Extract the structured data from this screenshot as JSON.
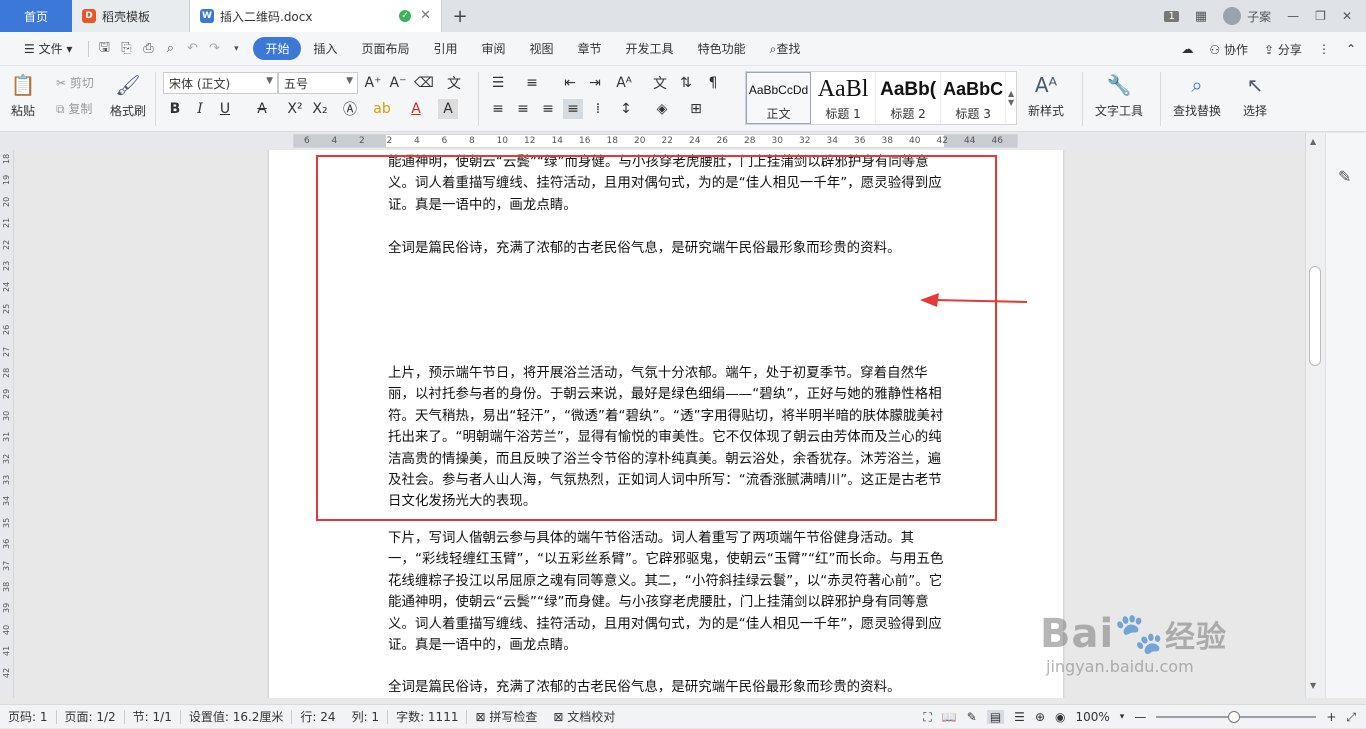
{
  "tabs": {
    "home": "首页",
    "docer": "稻壳模板",
    "doc": "插入二维码.docx",
    "new_tab": "+",
    "badge": "1",
    "user": "子案"
  },
  "menu": {
    "file": "文件",
    "items": [
      "开始",
      "插入",
      "页面布局",
      "引用",
      "审阅",
      "视图",
      "章节",
      "开发工具",
      "特色功能"
    ],
    "search": "查找",
    "collab": "协作",
    "share": "分享"
  },
  "ribbon": {
    "paste": "粘贴",
    "cut": "剪切",
    "copy": "复制",
    "format_painter": "格式刷",
    "font_name": "宋体 (正文)",
    "font_size": "五号",
    "styles": [
      {
        "preview": "AaBbCcDd",
        "name": "正文"
      },
      {
        "preview": "AaBl",
        "name": "标题 1"
      },
      {
        "preview": "AaBb(",
        "name": "标题 2"
      },
      {
        "preview": "AaBbC",
        "name": "标题 3"
      }
    ],
    "new_style": "新样式",
    "text_tools": "文字工具",
    "find_replace": "查找替换",
    "select": "选择"
  },
  "ruler_numbers": [
    "6",
    "4",
    "2",
    "2",
    "4",
    "6",
    "8",
    "10",
    "12",
    "14",
    "16",
    "18",
    "20",
    "22",
    "24",
    "26",
    "28",
    "30",
    "32",
    "34",
    "36",
    "38",
    "40",
    "42",
    "44",
    "46"
  ],
  "vruler_numbers": [
    "18",
    "19",
    "20",
    "21",
    "22",
    "23",
    "24",
    "25",
    "26",
    "27",
    "28",
    "29",
    "30",
    "31",
    "32",
    "33",
    "34",
    "35",
    "36",
    "37",
    "38",
    "39",
    "40",
    "41",
    "42"
  ],
  "document": {
    "p1": "能通神明，使朝云“云鬓”“绿”而身健。与小孩穿老虎腰肚，门上挂蒲剑以辟邪护身有同等意义。词人着重描写缠线、挂符活动，且用对偶句式，为的是“佳人相见一千年”，愿灵验得到应证。真是一语中的，画龙点睛。",
    "p2": "全词是篇民俗诗，充满了浓郁的古老民俗气息，是研究端午民俗最形象而珍贵的资料。",
    "p3": "上片，预示端午节日，将开展浴兰活动，气氛十分浓郁。端午，处于初夏季节。穿着自然华丽，以衬托参与者的身份。于朝云来说，最好是绿色细绢——“碧纨”，正好与她的雅静性格相符。天气稍热，易出“轻汗”，“微透”着“碧纨”。“透”字用得贴切，将半明半暗的肤体朦胧美衬托出来了。“明朝端午浴芳兰”，显得有愉悦的审美性。它不仅体现了朝云由芳体而及兰心的纯洁高贵的情操美，而且反映了浴兰令节俗的淳朴纯真美。朝云浴处，余香犹存。沐芳浴兰，遍及社会。参与者人山人海，气氛热烈，正如词人词中所写：“流香涨腻满晴川”。这正是古老节日文化发扬光大的表现。",
    "p4": "下片，写词人偕朝云参与具体的端午节俗活动。词人着重写了两项端午节俗健身活动。其一，“彩线轻缠红玉臂”，“以五彩丝系臂”。它辟邪驱鬼，使朝云“玉臂”“红”而长命。与用五色花线缠粽子投江以吊屈原之魂有同等意义。其二，“小符斜挂绿云鬟”，以“赤灵符著心前”。它能通神明，使朝云“云鬓”“绿”而身健。与小孩穿老虎腰肚，门上挂蒲剑以辟邪护身有同等意义。词人着重描写缠线、挂符活动，且用对偶句式，为的是“佳人相见一千年”，愿灵验得到应证。真是一语中的，画龙点睛。",
    "p5": "全词是篇民俗诗，充满了浓郁的古老民俗气息，是研究端午民俗最形象而珍贵的资料。"
  },
  "status": {
    "page_num": "页码: 1",
    "pages": "页面: 1/2",
    "section": "节: 1/1",
    "setting": "设置值: 16.2厘米",
    "row": "行: 24",
    "col": "列: 1",
    "words": "字数: 1111",
    "spell": "拼写检查",
    "proof": "文档校对",
    "zoom": "100%"
  },
  "watermark": {
    "brand": "Bai",
    "brand2": "经验",
    "url": "jingyan.baidu.com"
  },
  "colors": {
    "accent": "#3b78d8",
    "highlight_box": "#e53935"
  }
}
